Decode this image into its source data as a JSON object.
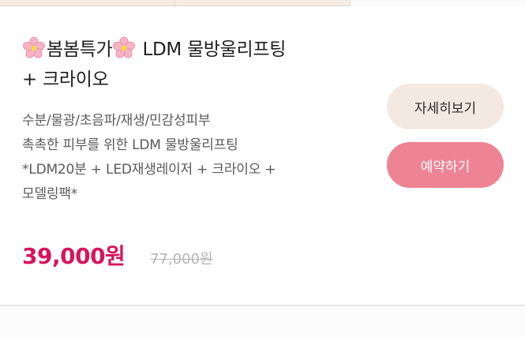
{
  "product": {
    "title_prefix": "봄봄특가",
    "title_main": " LDM 물방울리프팅",
    "title_line2": "+ 크라이오",
    "description": "수분/물광/초음파/재생/민감성피부\n촉촉한 피부를 위한 LDM 물방울리프팅\n *LDM20분 + LED재생레이저 + 크라이오 +\n모델링팩*",
    "price": "39,000원",
    "original_price": "77,000원"
  },
  "buttons": {
    "detail_label": "자세히보기",
    "reserve_label": "예약하기"
  },
  "icons": {
    "flower_icon": "cherry-blossom"
  },
  "colors": {
    "price": "#d8145a",
    "reserve_button": "#ee8394",
    "detail_button": "#f3e9e0",
    "top_bar": "#f5ede5"
  }
}
